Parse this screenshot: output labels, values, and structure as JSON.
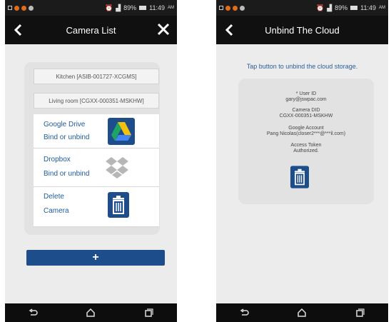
{
  "screen1": {
    "status": {
      "time": "11:49",
      "ampm": "AM",
      "battery": "89%"
    },
    "title": "Camera List",
    "cameras": [
      {
        "label": "Kitchen [ASIB-001727-XCGMS]"
      },
      {
        "label": "Living room [CGXX-000351-MSKHW]"
      }
    ],
    "options": [
      {
        "line1": "Google Drive",
        "line2": "Bind or unbind",
        "icon": "google-drive-icon"
      },
      {
        "line1": "Dropbox",
        "line2": "Bind or unbind",
        "icon": "dropbox-icon"
      },
      {
        "line1": "Delete",
        "line2": "Camera",
        "icon": "trash-icon"
      }
    ],
    "add_label": "+",
    "colors": {
      "accent": "#1d4e8b",
      "link": "#1f5b9a",
      "bar": "#101010"
    }
  },
  "screen2": {
    "status": {
      "time": "11:49",
      "ampm": "AM",
      "battery": "89%"
    },
    "title": "Unbind The Cloud",
    "hint": "Tap button to unbind the cloud storage.",
    "user_id_label": "* User ID",
    "user_id_value": "gary@jswpac.com",
    "camera_did_label": "Camera DID",
    "camera_did_value": "CGXX-000351-MSKHW",
    "google_account_label": "Google Account",
    "google_account_value": "Pang Nicolas(closer2***@***il.com)",
    "access_token_label": "Access Token",
    "access_token_value": "Authorized."
  }
}
